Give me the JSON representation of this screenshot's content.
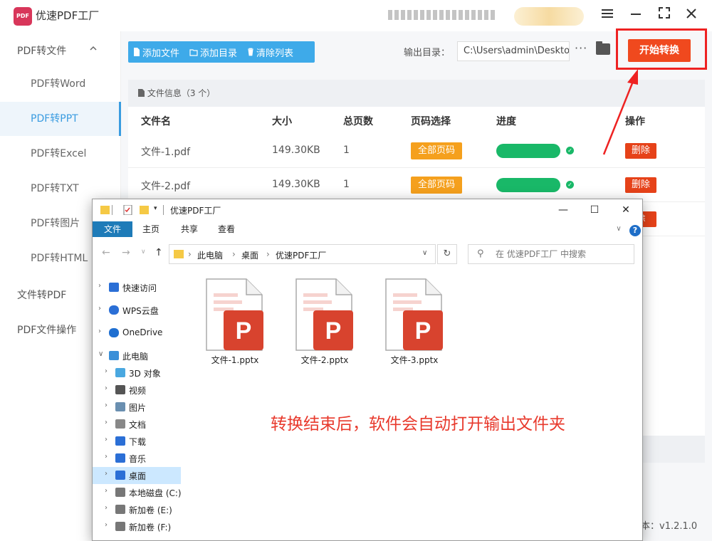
{
  "app": {
    "title": "优速PDF工厂",
    "logo_text": "PDF"
  },
  "window_controls": {
    "menu_icon": "hamburger-icon",
    "minimize_icon": "minimize-icon",
    "maximize_icon": "maximize-icon",
    "close_icon": "close-icon"
  },
  "sidebar": {
    "groups": [
      {
        "label": "PDF转文件"
      },
      {
        "label": "文件转PDF"
      },
      {
        "label": "PDF文件操作"
      }
    ],
    "items": [
      {
        "label": "PDF转Word"
      },
      {
        "label": "PDF转PPT"
      },
      {
        "label": "PDF转Excel"
      },
      {
        "label": "PDF转TXT"
      },
      {
        "label": "PDF转图片"
      },
      {
        "label": "PDF转HTML"
      }
    ]
  },
  "toolbar": {
    "add_file": "添加文件",
    "add_dir": "添加目录",
    "clear_list": "清除列表",
    "output_label": "输出目录：",
    "output_path": "C:\\Users\\admin\\Desktop",
    "more": "···",
    "start": "开始转换"
  },
  "panel": {
    "header": "文件信息（",
    "header_count": "3 个",
    "header_close": "）",
    "columns": {
      "name": "文件名",
      "size": "大小",
      "pages": "总页数",
      "page_select": "页码选择",
      "progress": "进度",
      "action": "操作"
    },
    "rows": [
      {
        "name": "文件-1.pdf",
        "size": "149.30KB",
        "pages": "1",
        "page_select": "全部页码",
        "progress": 1.0,
        "action": "删除"
      },
      {
        "name": "文件-2.pdf",
        "size": "149.30KB",
        "pages": "1",
        "page_select": "全部页码",
        "progress": 1.0,
        "action": "删除"
      }
    ],
    "row3_action_partial": "除"
  },
  "version": "本：v1.2.1.0",
  "explorer": {
    "title": "优速PDF工厂",
    "ribbon_tabs": [
      "文件",
      "主页",
      "共享",
      "查看"
    ],
    "help": "?",
    "breadcrumb": [
      "此电脑",
      "桌面",
      "优速PDF工厂"
    ],
    "search_placeholder": "在 优速PDF工厂 中搜索",
    "nav": [
      {
        "label": "快速访问",
        "icon": "star-icon"
      },
      {
        "label": "WPS云盘",
        "icon": "cloud-icon"
      },
      {
        "label": "OneDrive",
        "icon": "onedrive-icon"
      },
      {
        "label": "此电脑",
        "icon": "computer-icon"
      },
      {
        "label": "3D 对象",
        "icon": "cube-icon"
      },
      {
        "label": "视频",
        "icon": "video-icon"
      },
      {
        "label": "图片",
        "icon": "picture-icon"
      },
      {
        "label": "文档",
        "icon": "document-icon"
      },
      {
        "label": "下载",
        "icon": "download-icon"
      },
      {
        "label": "音乐",
        "icon": "music-icon"
      },
      {
        "label": "桌面",
        "icon": "desktop-icon"
      },
      {
        "label": "本地磁盘 (C:)",
        "icon": "drive-icon"
      },
      {
        "label": "新加卷 (E:)",
        "icon": "drive-icon"
      },
      {
        "label": "新加卷 (F:)",
        "icon": "drive-icon"
      }
    ],
    "files": [
      {
        "name": "文件-1.pptx",
        "icon": "pptx-file-icon",
        "letter": "P"
      },
      {
        "name": "文件-2.pptx",
        "icon": "pptx-file-icon",
        "letter": "P"
      },
      {
        "name": "文件-3.pptx",
        "icon": "pptx-file-icon",
        "letter": "P"
      }
    ]
  },
  "annotation": "转换结束后，软件会自动打开输出文件夹",
  "colors": {
    "accent_blue": "#3eaae9",
    "start_orange": "#f0491e",
    "progress_green": "#19b868",
    "page_orange": "#f5a01d",
    "delete_red": "#e64219",
    "annotation_red": "#e8392c"
  }
}
